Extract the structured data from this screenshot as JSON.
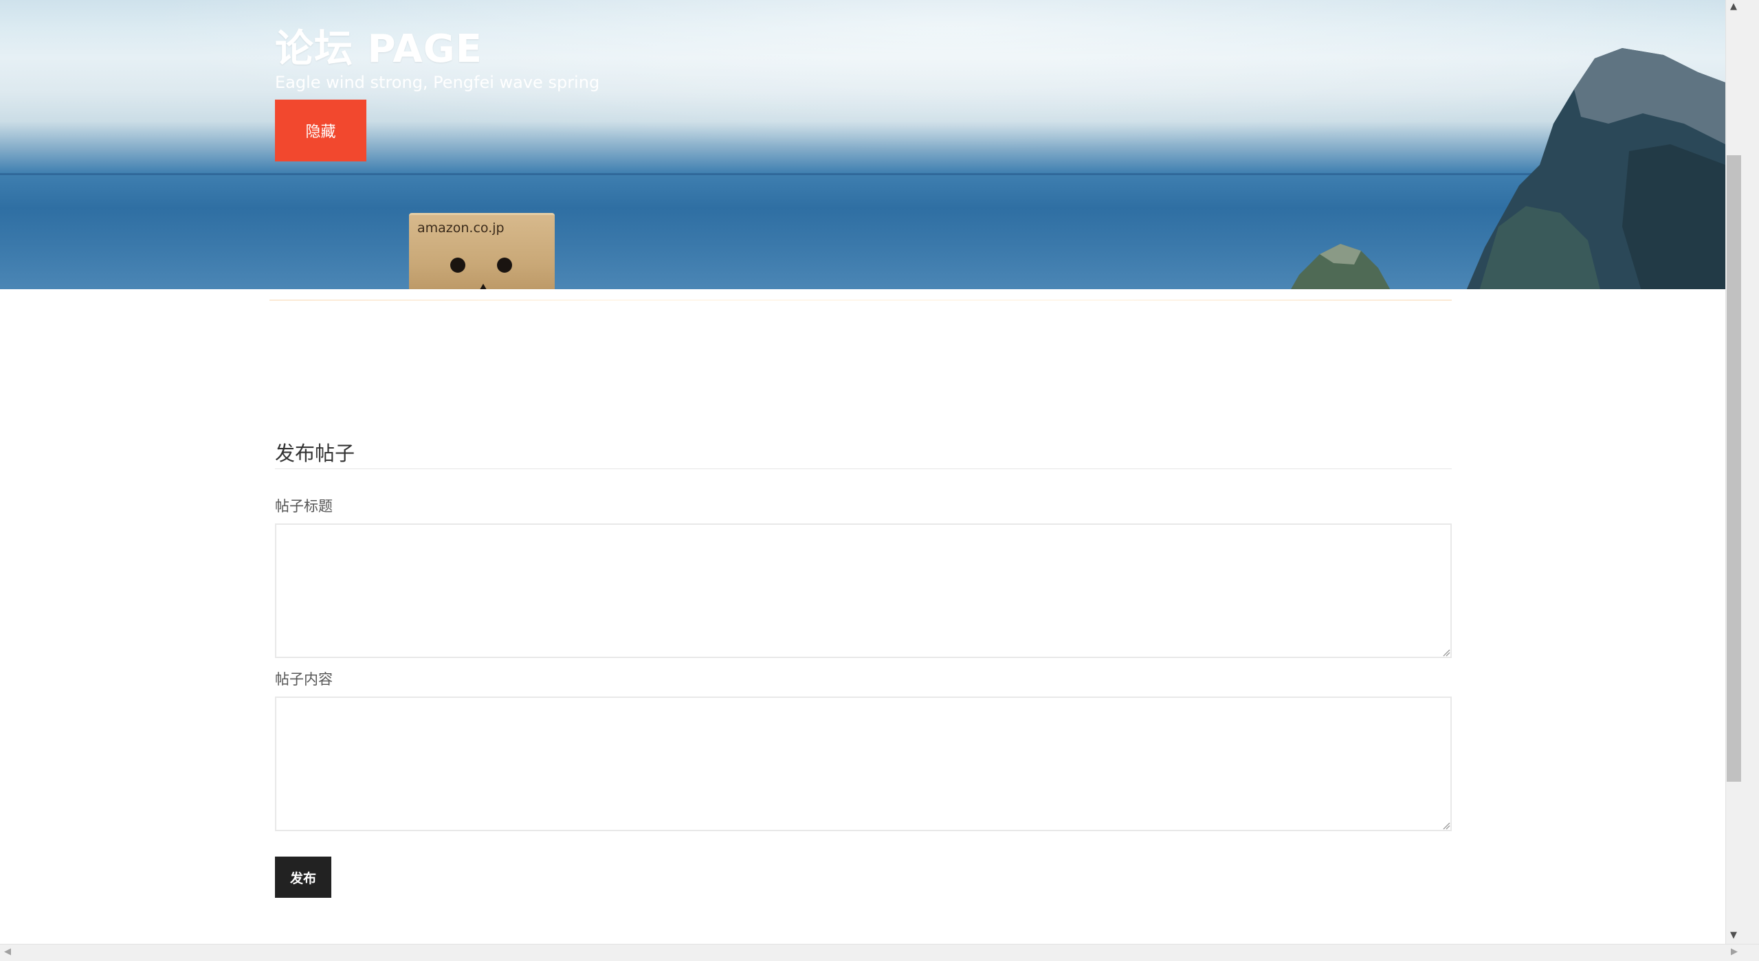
{
  "hero": {
    "title": "论坛 PAGE",
    "subtitle": "Eagle wind strong, Pengfei wave spring",
    "hide_button_label": "隐藏",
    "box_logo": "amazon.co.jp"
  },
  "form": {
    "heading": "发布帖子",
    "title_label": "帖子标题",
    "title_value": "",
    "content_label": "帖子内容",
    "content_value": "",
    "submit_label": "发布"
  },
  "scrollbars": {
    "up_icon": "triangle-up-icon",
    "down_icon": "triangle-down-icon",
    "left_icon": "triangle-left-icon",
    "right_icon": "triangle-right-icon"
  },
  "colors": {
    "accent": "#f2482e",
    "submit": "#222222",
    "text": "#333333"
  }
}
